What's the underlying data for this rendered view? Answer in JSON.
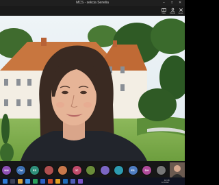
{
  "window": {
    "title": "MCS - sekcia Senelia",
    "controls": [
      "–",
      "□",
      "✕"
    ]
  },
  "toolbar": {
    "items": [
      {
        "icon": "view-icon",
        "label": "View"
      },
      {
        "icon": "people-icon",
        "label": "People"
      },
      {
        "icon": "close-icon",
        "label": "Leave"
      }
    ]
  },
  "participants": [
    {
      "initials": "MH",
      "color": "#8e4fb5"
    },
    {
      "initials": "CM",
      "color": "#3d6fb0"
    },
    {
      "initials": "ES",
      "color": "#2f8f7a"
    },
    {
      "initials": "",
      "color": "#b05050"
    },
    {
      "initials": "",
      "color": "#c9784b"
    },
    {
      "initials": "JC",
      "color": "#c04a6a"
    },
    {
      "initials": "",
      "color": "#6a8c3a"
    },
    {
      "initials": "",
      "color": "#7b66c4"
    },
    {
      "initials": "",
      "color": "#2d9bb0"
    },
    {
      "initials": "ES",
      "color": "#4f7cc0"
    },
    {
      "initials": "DH",
      "color": "#b04a9a"
    },
    {
      "initials": "",
      "color": "#777777"
    }
  ],
  "taskbar": {
    "time": "10:48",
    "date": "12.4.2022"
  }
}
